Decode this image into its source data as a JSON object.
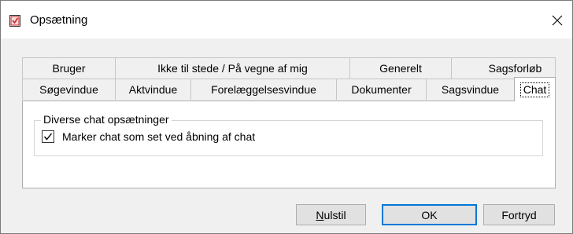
{
  "window": {
    "title": "Opsætning",
    "icon": "settings-app-icon",
    "close_glyph": "✕"
  },
  "tabs": {
    "row1": [
      {
        "label": "Bruger"
      },
      {
        "label": "Ikke til stede / På vegne af mig"
      },
      {
        "label": "Generelt"
      },
      {
        "label": "Sagsforløb"
      }
    ],
    "row2": [
      {
        "label": "Søgevindue"
      },
      {
        "label": "Aktvindue"
      },
      {
        "label": "Forelæggelsesvindue"
      },
      {
        "label": "Dokumenter"
      },
      {
        "label": "Sagsvindue"
      },
      {
        "label": "Chat",
        "active": true
      }
    ]
  },
  "panel": {
    "group_title": "Diverse chat opsætninger",
    "checkbox_label": "Marker chat som set ved åbning af chat",
    "checkbox_checked": true
  },
  "buttons": {
    "reset_first": "N",
    "reset_rest": "ulstil",
    "ok": "OK",
    "cancel": "Fortryd"
  },
  "colors": {
    "accent": "#0078d7",
    "panel_bg": "#ffffff",
    "window_bg": "#f0f0f0"
  }
}
